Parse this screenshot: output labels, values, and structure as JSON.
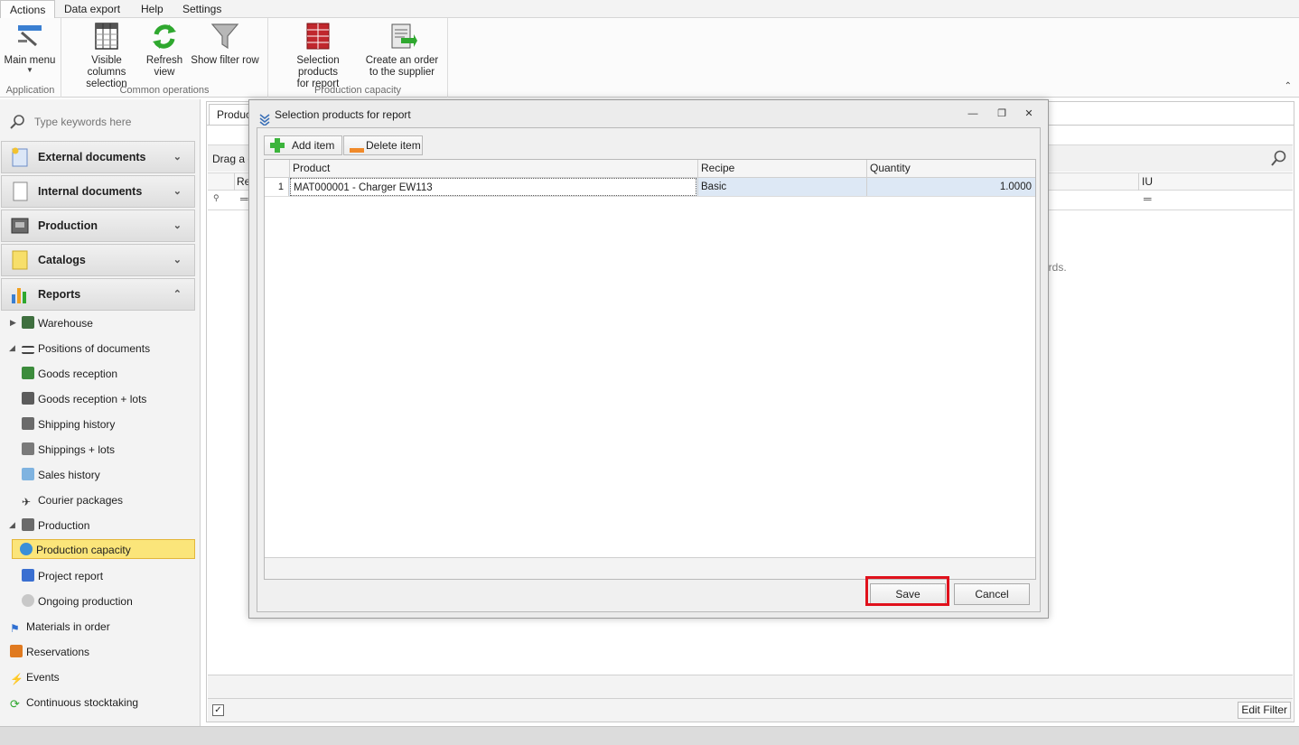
{
  "ribbon": {
    "tabs": [
      "Actions",
      "Data export",
      "Help",
      "Settings"
    ],
    "groups": {
      "application": "Application",
      "common": "Common operations",
      "production_capacity": "Production capacity"
    },
    "buttons": {
      "main_menu": "Main menu",
      "visible_columns_1": "Visible columns",
      "visible_columns_2": "selection",
      "refresh_1": "Refresh",
      "refresh_2": "view",
      "show_filter_row": "Show filter row",
      "selection_products_1": "Selection products",
      "selection_products_2": "for report",
      "create_order_1": "Create an order",
      "create_order_2": "to the supplier"
    }
  },
  "sidebar": {
    "search_placeholder": "Type keywords here",
    "sections": [
      {
        "label": "External documents",
        "expanded": false
      },
      {
        "label": "Internal documents",
        "expanded": false
      },
      {
        "label": "Production",
        "expanded": false
      },
      {
        "label": "Catalogs",
        "expanded": false
      },
      {
        "label": "Reports",
        "expanded": true
      }
    ],
    "tree": [
      "Warehouse",
      "Positions of documents",
      "Goods reception",
      "Goods reception + lots",
      "Shipping history",
      "Shippings + lots",
      "Sales history",
      "Courier packages",
      "Production",
      "Production capacity",
      "Project report",
      "Ongoing production",
      "Materials in order",
      "Reservations",
      "Events",
      "Continuous stocktaking"
    ]
  },
  "main": {
    "tab_label": "Product",
    "group_panel_text": "Drag a c",
    "col_re": "Re",
    "col_iu": "IU",
    "empty_text": "ords.",
    "edit_filter": "Edit Filter"
  },
  "dialog": {
    "title": "Selection products for report",
    "add_item": "Add item",
    "delete_item": "Delete item",
    "columns": [
      "Product",
      "Recipe",
      "Quantity"
    ],
    "rows": [
      {
        "num": "1",
        "product": "MAT000001 - Charger EW113",
        "recipe": "Basic",
        "quantity": "1.0000"
      }
    ],
    "save": "Save",
    "cancel": "Cancel"
  },
  "colors": {
    "selected_nav": "#fbe57a",
    "highlight": "#e0111c",
    "row_selected": "#dde8f5"
  }
}
